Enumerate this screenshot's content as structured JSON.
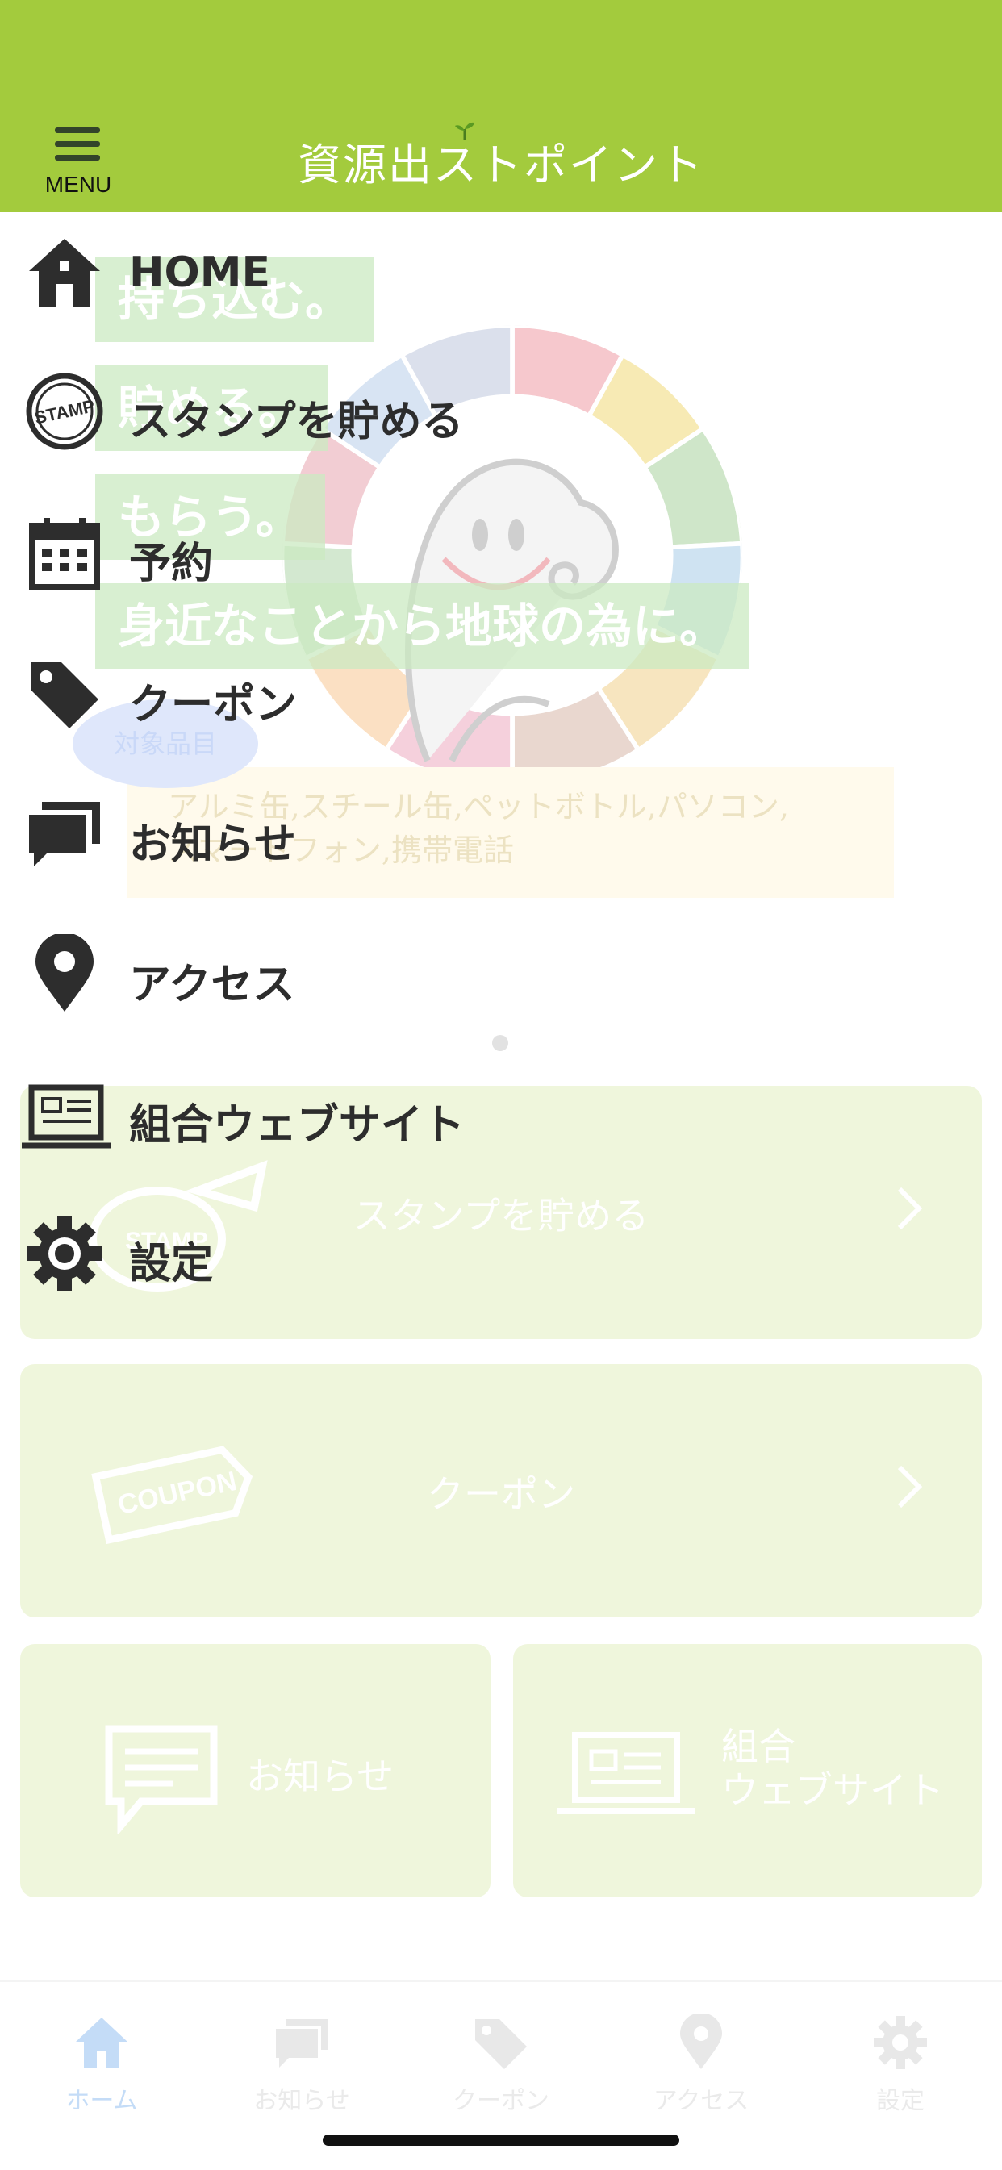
{
  "header": {
    "title": "資源出ストポイント",
    "menu_label": "MENU",
    "background_color": "#a3cb3d"
  },
  "drawer": {
    "items": [
      {
        "label": "HOME",
        "icon": "home-icon"
      },
      {
        "label": "スタンプを貯める",
        "icon": "stamp-icon"
      },
      {
        "label": "予約",
        "icon": "calendar-icon"
      },
      {
        "label": "クーポン",
        "icon": "tag-icon"
      },
      {
        "label": "お知らせ",
        "icon": "chat-icon"
      },
      {
        "label": "アクセス",
        "icon": "map-pin-icon"
      },
      {
        "label": "組合ウェブサイト",
        "icon": "laptop-icon"
      },
      {
        "label": "設定",
        "icon": "gear-icon"
      }
    ]
  },
  "background_page": {
    "catchphrases": [
      "持ち込む。",
      "貯める。",
      "もらう。",
      "身近なことから地球の為に。"
    ],
    "target_title": "対象品目",
    "target_text_line1": "アルミ缶,スチール缶,ペットボトル,パソコン,",
    "target_text_line2": "スマートフォン,携帯電話",
    "cards": {
      "stamp": "スタンプを貯める",
      "coupon": "クーポン",
      "coupon_icon_text": "COUPON",
      "stamp_icon_text": "STAMP",
      "news": "お知らせ",
      "website_line1": "組合",
      "website_line2": "ウェブサイト"
    }
  },
  "tabbar": {
    "items": [
      {
        "label": "ホーム",
        "icon": "home-icon",
        "active": true
      },
      {
        "label": "お知らせ",
        "icon": "chat-icon",
        "active": false
      },
      {
        "label": "クーポン",
        "icon": "tag-icon",
        "active": false
      },
      {
        "label": "アクセス",
        "icon": "map-pin-icon",
        "active": false
      },
      {
        "label": "設定",
        "icon": "gear-icon",
        "active": false
      }
    ]
  },
  "colors": {
    "accent_green": "#a3cb3d",
    "card_bg": "#eff6dc",
    "menu_text": "#2d2d2d"
  }
}
